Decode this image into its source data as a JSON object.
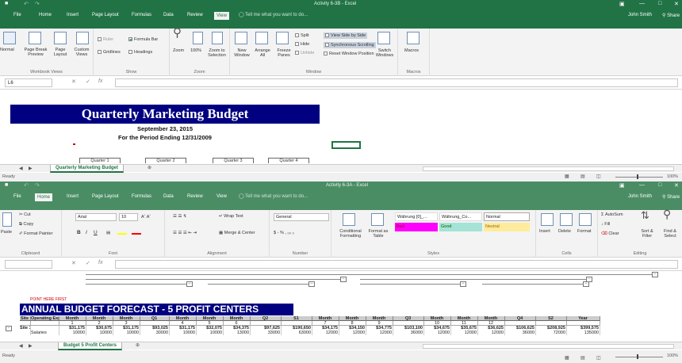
{
  "win1": {
    "title": "Activity 6-3B - Excel",
    "tabs": [
      "File",
      "Home",
      "Insert",
      "Page Layout",
      "Formulas",
      "Data",
      "Review",
      "View"
    ],
    "active_tab": "View",
    "tell_me": "Tell me what you want to do...",
    "user": "John Smith",
    "share": "Share",
    "ribbon": {
      "workbook_views": {
        "label": "Workbook Views",
        "items": [
          "Normal",
          "Page Break Preview",
          "Page Layout",
          "Custom Views"
        ]
      },
      "show": {
        "label": "Show",
        "ruler": "Ruler",
        "formula_bar": "Formula Bar",
        "gridlines": "Gridlines",
        "headings": "Headings"
      },
      "zoom": {
        "label": "Zoom",
        "items": [
          "Zoom",
          "100%",
          "Zoom to Selection"
        ]
      },
      "window": {
        "label": "Window",
        "items": [
          "New Window",
          "Arrange All",
          "Freeze Panes"
        ],
        "split": "Split",
        "hide": "Hide",
        "unhide": "Unhide",
        "side": "View Side by Side",
        "sync": "Synchronous Scrolling",
        "reset": "Reset Window Position",
        "switch": "Switch Windows"
      },
      "macros": {
        "label": "Macros",
        "item": "Macros"
      }
    },
    "namebox": "L6",
    "sheet": {
      "title": "Quarterly Marketing Budget",
      "date": "September 23, 2015",
      "period": "For the Period Ending 12/31/2009",
      "quarters": [
        "Quarter 1",
        "Quarter 2",
        "Quarter 3",
        "Quarter 4"
      ]
    },
    "sheet_tab": "Quarterly Marketing Budget",
    "status": "Ready"
  },
  "win2": {
    "title": "Activity 6-3A - Excel",
    "tabs": [
      "File",
      "Home",
      "Insert",
      "Page Layout",
      "Formulas",
      "Data",
      "Review",
      "View"
    ],
    "active_tab": "Home",
    "tell_me": "Tell me what you want to do...",
    "user": "John Smith",
    "share": "Share",
    "ribbon": {
      "clipboard": {
        "label": "Clipboard",
        "paste": "Paste",
        "cut": "Cut",
        "copy": "Copy",
        "painter": "Format Painter"
      },
      "font": {
        "label": "Font",
        "name": "Arial",
        "size": "10"
      },
      "alignment": {
        "label": "Alignment",
        "wrap": "Wrap Text",
        "merge": "Merge & Center"
      },
      "number": {
        "label": "Number",
        "format": "General"
      },
      "styles": {
        "label": "Styles",
        "conditional": "Conditional Formatting",
        "format_as": "Format as Table",
        "cells": [
          "Währung [0]_...",
          "Währung_Co...",
          "Normal",
          "Bad",
          "Good",
          "Neutral"
        ]
      },
      "cells": {
        "label": "Cells",
        "items": [
          "Insert",
          "Delete",
          "Format"
        ]
      },
      "editing": {
        "label": "Editing",
        "autosum": "AutoSum",
        "fill": "Fill",
        "clear": "Clear",
        "sort": "Sort & Filter",
        "find": "Find & Select"
      }
    },
    "namebox": "",
    "sheet": {
      "point": "POINT HERE FIRST",
      "title": "ANNUAL BUDGET FORECAST - 5 PROFIT CENTERS",
      "headers": [
        "Site",
        "Operating Exp",
        "Month",
        "Month",
        "Month",
        "Q1",
        "Month",
        "Month",
        "Month",
        "Q2",
        "S1",
        "Month",
        "Month",
        "Month",
        "Q3",
        "Month",
        "Month",
        "Month",
        "Q4",
        "S2",
        "Year"
      ],
      "numbers": [
        "",
        "",
        "1",
        "2",
        "3",
        "",
        "4",
        "5",
        "6",
        "",
        "",
        "7",
        "8",
        "9",
        "",
        "10",
        "11",
        "12",
        "",
        "",
        ""
      ],
      "row_site": [
        "Site 1",
        "",
        "$31,175",
        "$30,675",
        "$31,175",
        "$93,025",
        "$31,175",
        "$32,075",
        "$34,375",
        "$97,625",
        "$190,650",
        "$34,175",
        "$34,150",
        "$34,775",
        "$103,100",
        "$34,675",
        "$35,675",
        "$36,625",
        "$106,625",
        "$208,925",
        "$399,575"
      ],
      "row_sal": [
        "",
        "Salaries",
        "10000",
        "10000",
        "10000",
        "30000",
        "10000",
        "10000",
        "13000",
        "33000",
        "63000",
        "12000",
        "12000",
        "12000",
        "36000",
        "12000",
        "12000",
        "12000",
        "36000",
        "72000",
        "135000"
      ]
    },
    "sheet_tab": "Budget 5 Profit Centers",
    "status": "Ready",
    "zoom_pct": "100%"
  }
}
